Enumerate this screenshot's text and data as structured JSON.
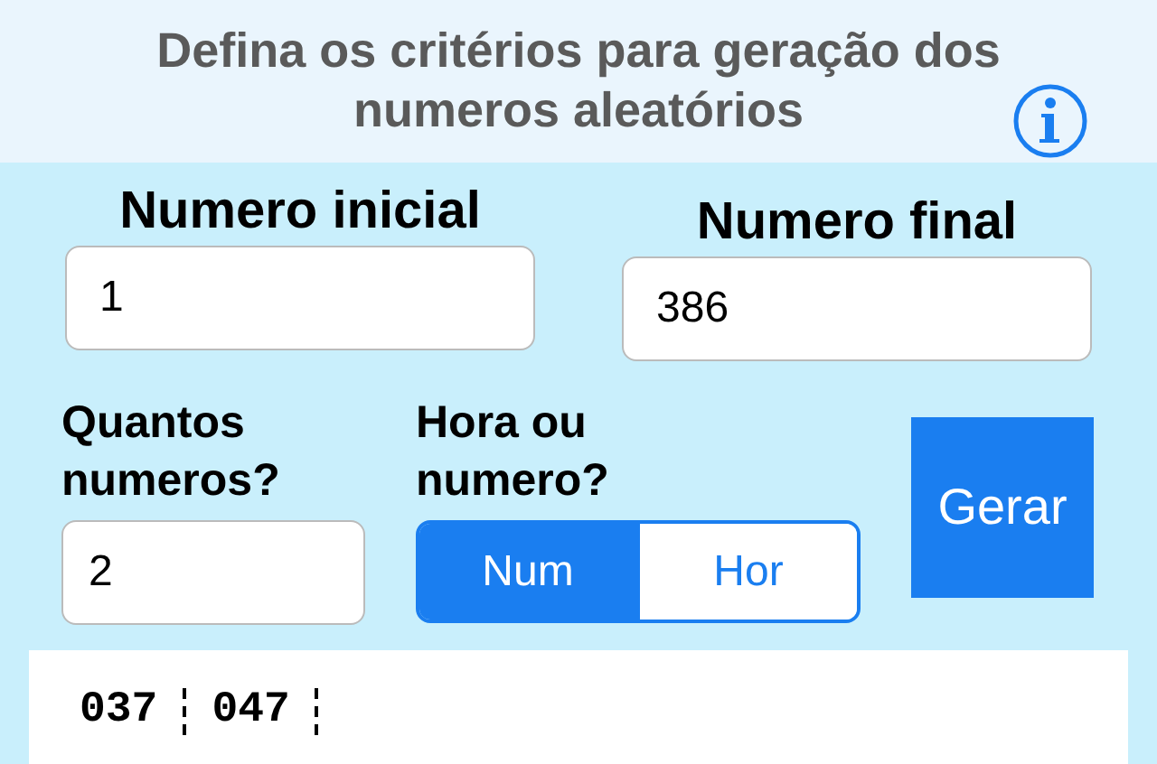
{
  "header": {
    "title": "Defina os critérios para geração dos numeros aleatórios"
  },
  "fields": [
    {
      "label": "Numero inicial",
      "value": "1"
    },
    {
      "label": "Numero final",
      "value": "386"
    }
  ],
  "count": {
    "label": "Quantos numeros?",
    "value": "2"
  },
  "mode": {
    "label": "Hora ou numero?",
    "options": [
      {
        "label": "Num",
        "selected": true
      },
      {
        "label": "Hor",
        "selected": false
      }
    ]
  },
  "generate_button": "Gerar",
  "results": [
    "037",
    "047"
  ]
}
